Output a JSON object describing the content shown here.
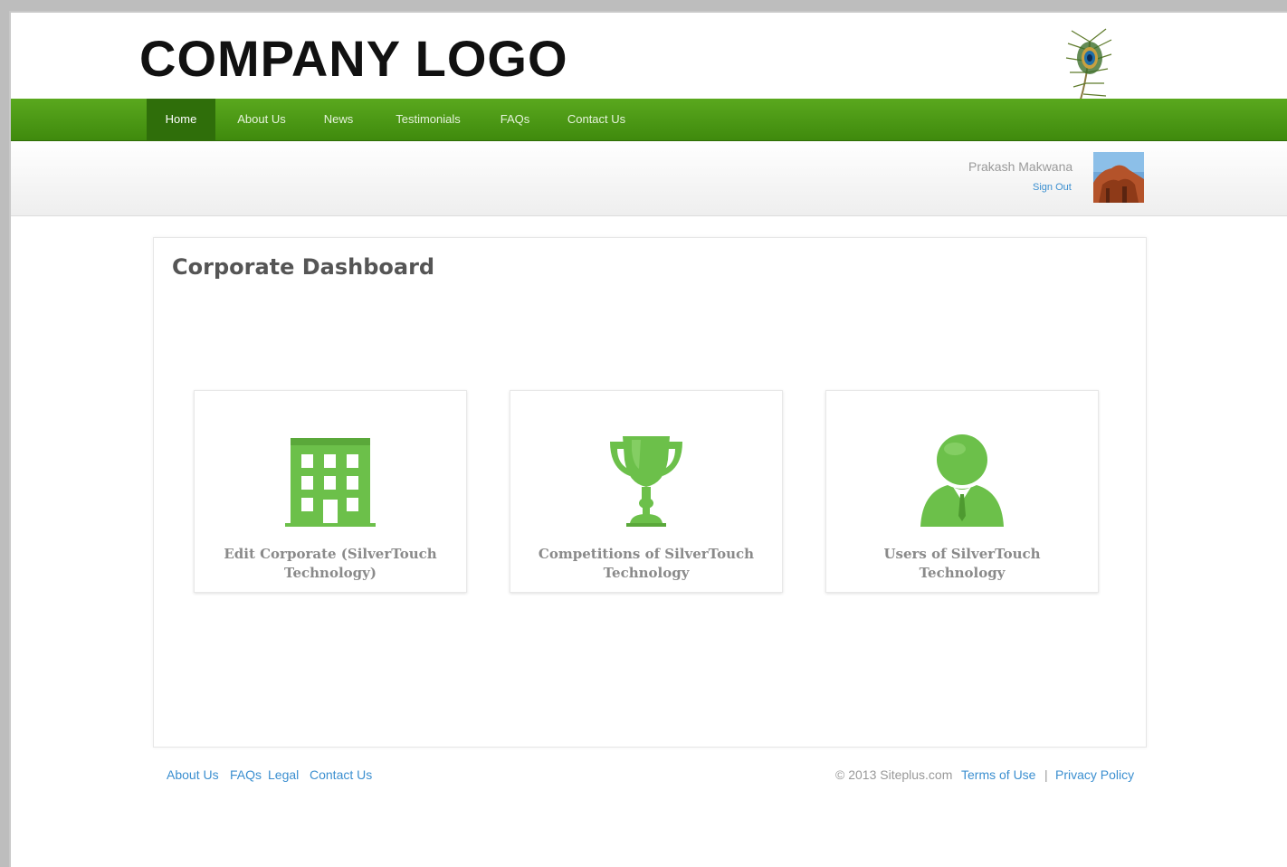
{
  "header": {
    "logo_text": "COMPANY LOGO"
  },
  "nav": {
    "items": [
      {
        "label": "Home",
        "active": true
      },
      {
        "label": "About Us",
        "active": false
      },
      {
        "label": "News",
        "active": false
      },
      {
        "label": "Testimonials",
        "active": false
      },
      {
        "label": "FAQs",
        "active": false
      },
      {
        "label": "Contact Us",
        "active": false
      }
    ]
  },
  "user": {
    "name": "Prakash Makwana",
    "sign_out": "Sign Out"
  },
  "dashboard": {
    "title": "Corporate Dashboard",
    "cards": [
      {
        "label": "Edit Corporate (SilverTouch Technology)",
        "icon": "building-icon"
      },
      {
        "label": "Competitions of SilverTouch Technology",
        "icon": "trophy-icon"
      },
      {
        "label": "Users of SilverTouch Technology",
        "icon": "user-icon"
      }
    ]
  },
  "footer": {
    "links": [
      "About Us",
      "FAQs",
      "Legal",
      "Contact Us"
    ],
    "copyright": "© 2013 Siteplus.com",
    "terms": "Terms of Use",
    "separator": "|",
    "privacy": "Privacy Policy"
  },
  "colors": {
    "nav_green": "#4a9a14",
    "nav_active": "#2f6e0a",
    "icon_green": "#6cc04a",
    "link_blue": "#3b8fd0"
  }
}
